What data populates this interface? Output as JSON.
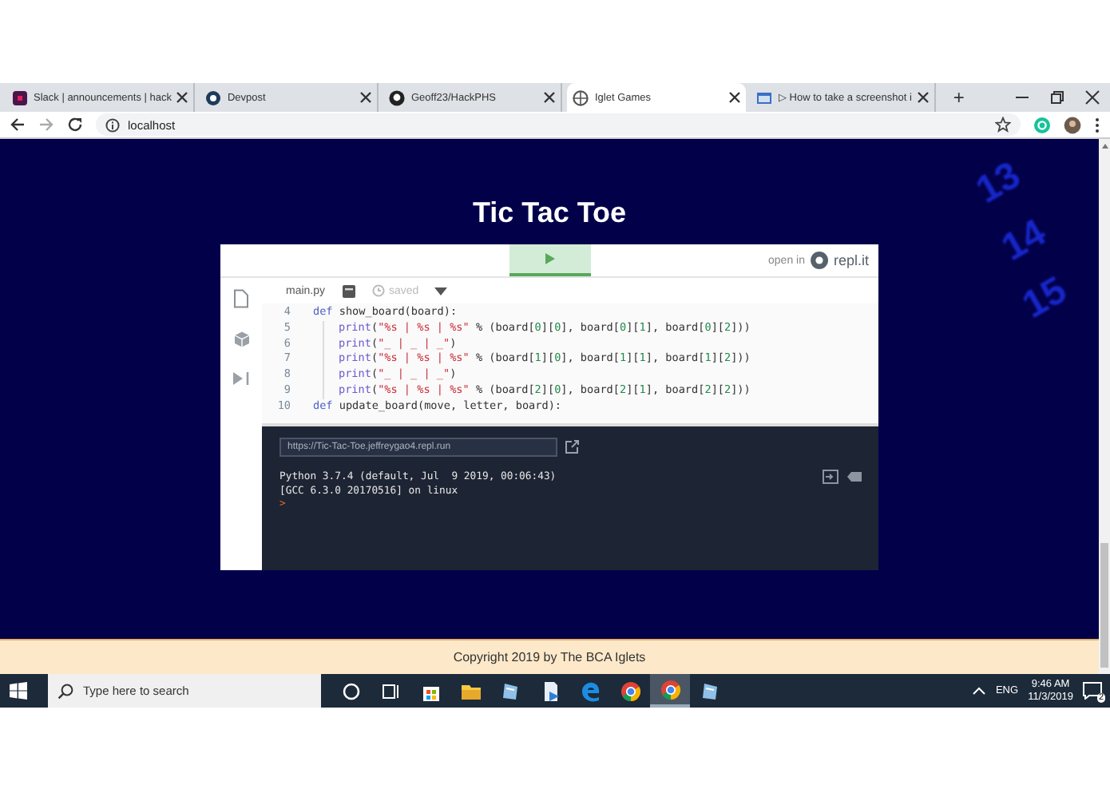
{
  "browser": {
    "tabs": [
      {
        "kind": "square",
        "title": "Slack | announcements | hack",
        "selected": false
      },
      {
        "kind": "ring",
        "title": "Devpost",
        "selected": false
      },
      {
        "kind": "cat",
        "title": "Geoff23/HackPHS",
        "selected": false
      },
      {
        "kind": "globe",
        "title": "Iglet Games",
        "selected": true
      },
      {
        "kind": "window",
        "title": "▷ How to take a screenshot i",
        "selected": false
      }
    ],
    "new_tab": "+",
    "address": "localhost"
  },
  "page": {
    "title": "Tic Tac Toe",
    "background_numbers": [
      "13",
      "14",
      "15"
    ],
    "embed": {
      "open_in": "open in",
      "brand": "repl.it",
      "file_tab": "main.py",
      "saved": "saved",
      "code_lines": [
        {
          "number": "4",
          "indented": false,
          "tokens": [
            {
              "kind": "keyword",
              "text": "def"
            },
            {
              "kind": "plain",
              "text": " show_board(board):"
            }
          ]
        },
        {
          "number": "5",
          "indented": true,
          "tokens": [
            {
              "kind": "builtin",
              "text": "print"
            },
            {
              "kind": "plain",
              "text": "("
            },
            {
              "kind": "string",
              "text": "\"%s | %s | %s\""
            },
            {
              "kind": "plain",
              "text": " % (board["
            },
            {
              "kind": "number",
              "text": "0"
            },
            {
              "kind": "plain",
              "text": "]["
            },
            {
              "kind": "number",
              "text": "0"
            },
            {
              "kind": "plain",
              "text": "], board["
            },
            {
              "kind": "number",
              "text": "0"
            },
            {
              "kind": "plain",
              "text": "]["
            },
            {
              "kind": "number",
              "text": "1"
            },
            {
              "kind": "plain",
              "text": "], board["
            },
            {
              "kind": "number",
              "text": "0"
            },
            {
              "kind": "plain",
              "text": "]["
            },
            {
              "kind": "number",
              "text": "2"
            },
            {
              "kind": "plain",
              "text": "]))"
            }
          ]
        },
        {
          "number": "6",
          "indented": true,
          "tokens": [
            {
              "kind": "builtin",
              "text": "print"
            },
            {
              "kind": "plain",
              "text": "("
            },
            {
              "kind": "string",
              "text": "\"_ | _ | _\""
            },
            {
              "kind": "plain",
              "text": ")"
            }
          ]
        },
        {
          "number": "7",
          "indented": true,
          "tokens": [
            {
              "kind": "builtin",
              "text": "print"
            },
            {
              "kind": "plain",
              "text": "("
            },
            {
              "kind": "string",
              "text": "\"%s | %s | %s\""
            },
            {
              "kind": "plain",
              "text": " % (board["
            },
            {
              "kind": "number",
              "text": "1"
            },
            {
              "kind": "plain",
              "text": "]["
            },
            {
              "kind": "number",
              "text": "0"
            },
            {
              "kind": "plain",
              "text": "], board["
            },
            {
              "kind": "number",
              "text": "1"
            },
            {
              "kind": "plain",
              "text": "]["
            },
            {
              "kind": "number",
              "text": "1"
            },
            {
              "kind": "plain",
              "text": "], board["
            },
            {
              "kind": "number",
              "text": "1"
            },
            {
              "kind": "plain",
              "text": "]["
            },
            {
              "kind": "number",
              "text": "2"
            },
            {
              "kind": "plain",
              "text": "]))"
            }
          ]
        },
        {
          "number": "8",
          "indented": true,
          "tokens": [
            {
              "kind": "builtin",
              "text": "print"
            },
            {
              "kind": "plain",
              "text": "("
            },
            {
              "kind": "string",
              "text": "\"_ | _ | _\""
            },
            {
              "kind": "plain",
              "text": ")"
            }
          ]
        },
        {
          "number": "9",
          "indented": true,
          "tokens": [
            {
              "kind": "builtin",
              "text": "print"
            },
            {
              "kind": "plain",
              "text": "("
            },
            {
              "kind": "string",
              "text": "\"%s | %s | %s\""
            },
            {
              "kind": "plain",
              "text": " % (board["
            },
            {
              "kind": "number",
              "text": "2"
            },
            {
              "kind": "plain",
              "text": "]["
            },
            {
              "kind": "number",
              "text": "0"
            },
            {
              "kind": "plain",
              "text": "], board["
            },
            {
              "kind": "number",
              "text": "2"
            },
            {
              "kind": "plain",
              "text": "]["
            },
            {
              "kind": "number",
              "text": "1"
            },
            {
              "kind": "plain",
              "text": "], board["
            },
            {
              "kind": "number",
              "text": "2"
            },
            {
              "kind": "plain",
              "text": "]["
            },
            {
              "kind": "number",
              "text": "2"
            },
            {
              "kind": "plain",
              "text": "]))"
            }
          ]
        },
        {
          "number": "10",
          "indented": false,
          "tokens": [
            {
              "kind": "keyword",
              "text": "def"
            },
            {
              "kind": "plain",
              "text": " update_board(move, letter, board):"
            }
          ]
        }
      ],
      "url": "https://Tic-Tac-Toe.jeffreygao4.repl.run",
      "console_lines": [
        "Python 3.7.4 (default, Jul  9 2019, 00:06:43)",
        "[GCC 6.3.0 20170516] on linux"
      ],
      "prompt": ">"
    },
    "footer": "Copyright 2019 by The BCA Iglets"
  },
  "taskbar": {
    "search_placeholder": "Type here to search",
    "apps": [
      {
        "kind": "circle",
        "selected": false
      },
      {
        "kind": "taskview",
        "selected": false
      },
      {
        "kind": "bag",
        "selected": false
      },
      {
        "kind": "folder",
        "selected": false
      },
      {
        "kind": "tile",
        "selected": false
      },
      {
        "kind": "doc",
        "selected": false
      },
      {
        "kind": "edge",
        "selected": false
      },
      {
        "kind": "chrome",
        "selected": false
      },
      {
        "kind": "chrome",
        "selected": true
      },
      {
        "kind": "tile",
        "selected": false
      }
    ],
    "language": "ENG",
    "time": "9:46 AM",
    "date": "11/3/2019",
    "notifications": "2"
  }
}
